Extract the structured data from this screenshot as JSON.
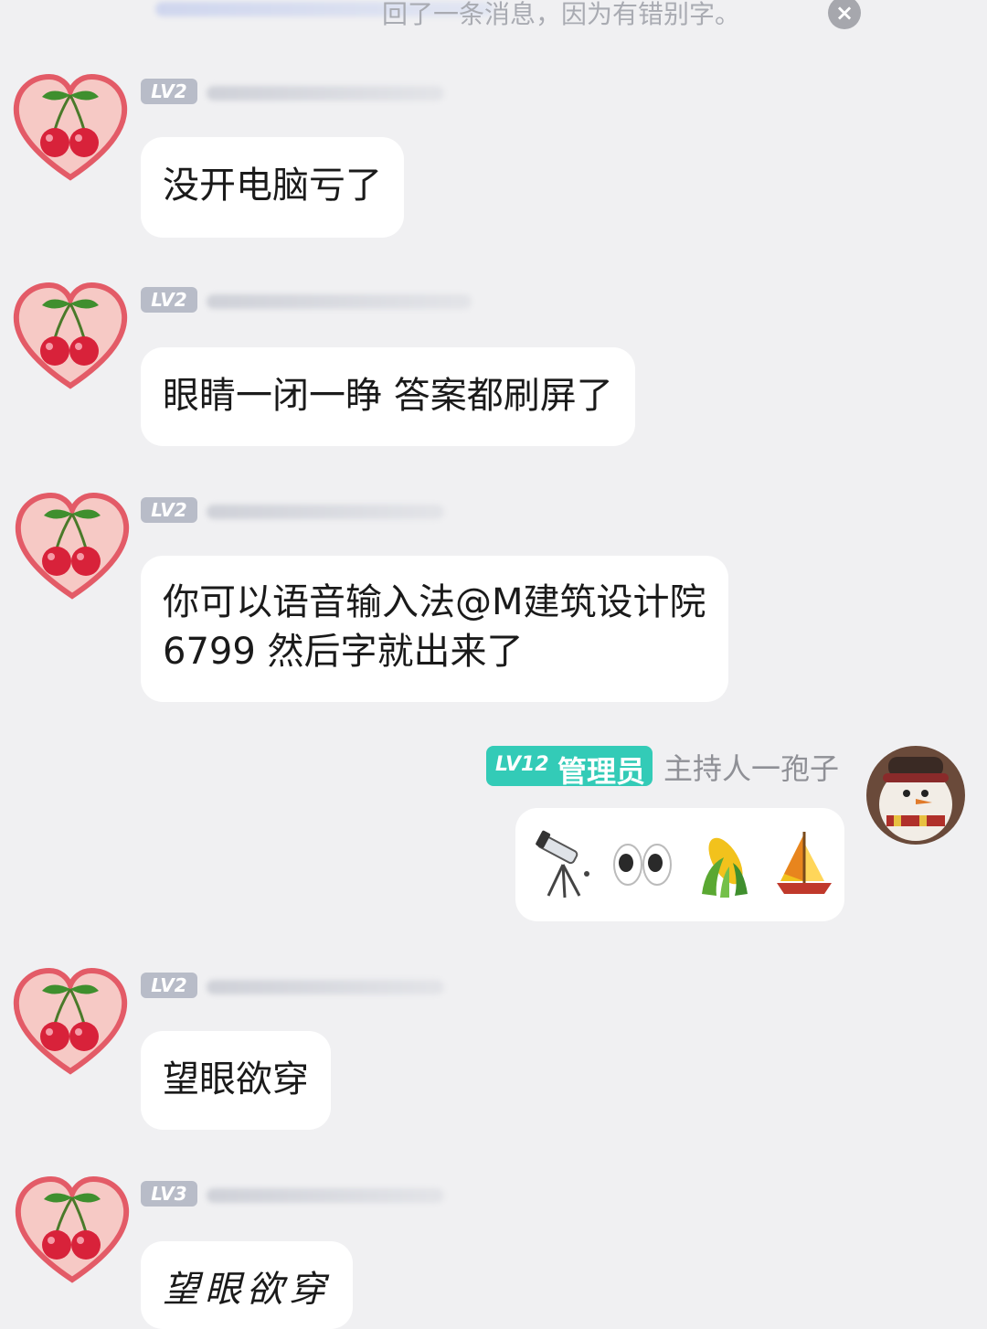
{
  "notice": {
    "text": "回了一条消息，因为有错别字。",
    "close_glyph": "×"
  },
  "messages": [
    {
      "level": "LV2",
      "text": "没开电脑亏了"
    },
    {
      "level": "LV2",
      "text": "眼睛一闭一睁 答案都刷屏了"
    },
    {
      "level": "LV2",
      "line1": "你可以语音输入法@M建筑设计院",
      "line2": "6799 然后字就出来了"
    },
    {
      "level": "LV12",
      "role": "管理员",
      "name": "主持人一孢子",
      "emoji_names": [
        "telescope-emoji",
        "eyes-emoji",
        "corn-emoji",
        "sailboat-emoji"
      ]
    },
    {
      "level": "LV2",
      "text": "望眼欲穿"
    },
    {
      "level": "LV3",
      "text": "望眼欲穿"
    }
  ],
  "colors": {
    "background": "#f0f0f2",
    "bubble": "#ffffff",
    "admin_badge": "#33cbb7",
    "level_badge": "#b8bcc8"
  }
}
